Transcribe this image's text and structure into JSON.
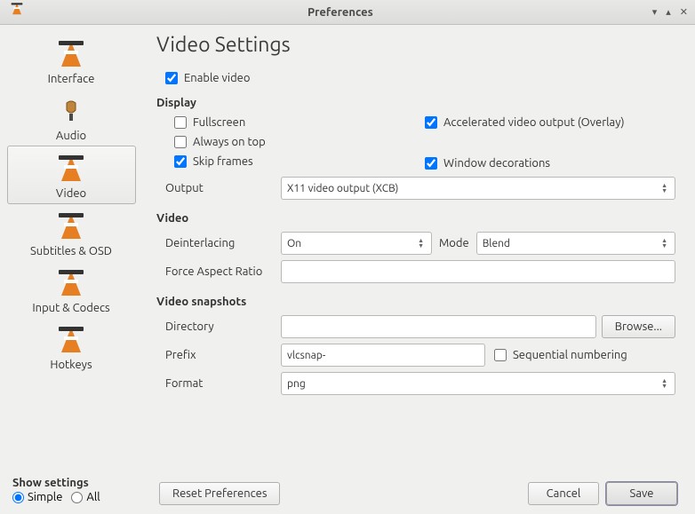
{
  "window": {
    "title": "Preferences"
  },
  "sidebar": {
    "items": [
      {
        "label": "Interface"
      },
      {
        "label": "Audio"
      },
      {
        "label": "Video"
      },
      {
        "label": "Subtitles & OSD"
      },
      {
        "label": "Input & Codecs"
      },
      {
        "label": "Hotkeys"
      }
    ]
  },
  "page_title": "Video Settings",
  "enable_video": {
    "label": "Enable video",
    "checked": true
  },
  "display": {
    "title": "Display",
    "fullscreen": {
      "label": "Fullscreen",
      "checked": false
    },
    "always_on_top": {
      "label": "Always on top",
      "checked": false
    },
    "skip_frames": {
      "label": "Skip frames",
      "checked": true
    },
    "accel": {
      "label": "Accelerated video output (Overlay)",
      "checked": true
    },
    "window_dec": {
      "label": "Window decorations",
      "checked": true
    },
    "output_label": "Output",
    "output_value": "X11 video output (XCB)"
  },
  "video": {
    "title": "Video",
    "deint_label": "Deinterlacing",
    "deint_value": "On",
    "mode_label": "Mode",
    "mode_value": "Blend",
    "far_label": "Force Aspect Ratio",
    "far_value": ""
  },
  "snapshots": {
    "title": "Video snapshots",
    "dir_label": "Directory",
    "dir_value": "",
    "browse": "Browse...",
    "prefix_label": "Prefix",
    "prefix_value": "vlcsnap-",
    "seq": {
      "label": "Sequential numbering",
      "checked": false
    },
    "format_label": "Format",
    "format_value": "png"
  },
  "show_settings": {
    "title": "Show settings",
    "simple": "Simple",
    "all": "All"
  },
  "buttons": {
    "reset": "Reset Preferences",
    "cancel": "Cancel",
    "save": "Save"
  }
}
